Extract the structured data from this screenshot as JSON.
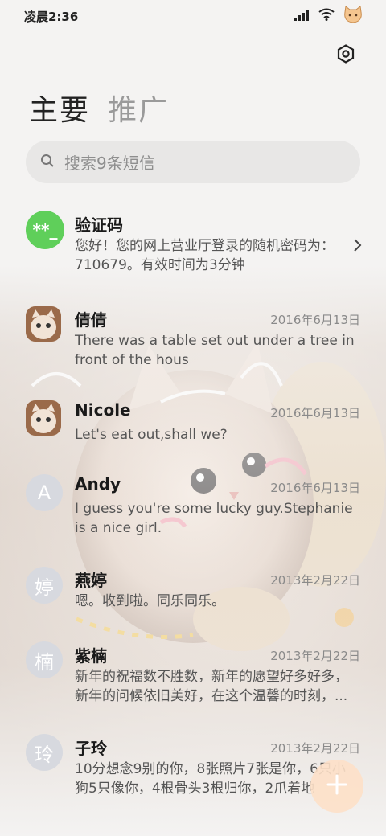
{
  "status": {
    "time": "凌晨2:36"
  },
  "tabs": [
    {
      "label": "主要"
    },
    {
      "label": "推广"
    }
  ],
  "search": {
    "placeholder": "搜索9条短信"
  },
  "messages": [
    {
      "avatar_text": "**_",
      "avatar_color": "#5fcf5a",
      "name": "验证码",
      "date": "",
      "preview": "您好！您的网上营业厅登录的随机密码为：710679。有效时间为3分钟"
    },
    {
      "avatar_text": "",
      "avatar_color": "#c9a27c",
      "name": "倩倩",
      "date": "2016年6月13日",
      "preview": "There was a table set out under a tree in front of the hous"
    },
    {
      "avatar_text": "",
      "avatar_color": "#c9a27c",
      "name": "Nicole",
      "date": "2016年6月13日",
      "preview": "Let's eat out,shall we?"
    },
    {
      "avatar_text": "A",
      "avatar_color": "#d7d9df",
      "name": "Andy",
      "date": "2016年6月13日",
      "preview": "I guess you're some lucky guy.Stephanie is a nice girl."
    },
    {
      "avatar_text": "婷",
      "avatar_color": "#d7d9df",
      "name": "燕婷",
      "date": "2013年2月22日",
      "preview": "嗯。收到啦。同乐同乐。"
    },
    {
      "avatar_text": "楠",
      "avatar_color": "#d7d9df",
      "name": "紫楠",
      "date": "2013年2月22日",
      "preview": "新年的祝福数不胜数，新年的愿望好多好多，新年的问候依旧美好，在这个温馨的时刻，..."
    },
    {
      "avatar_text": "玲",
      "avatar_color": "#d7d9df",
      "name": "子玲",
      "date": "2013年2月22日",
      "preview": "10分想念9别的你，8张照片7张是你，6只小狗5只像你，4根骨头3根归你，2爪着地"
    }
  ],
  "icons": {
    "settings": "gear-icon",
    "search": "search-icon",
    "compose": "plus-icon",
    "chevron": "chevron-right-icon"
  }
}
